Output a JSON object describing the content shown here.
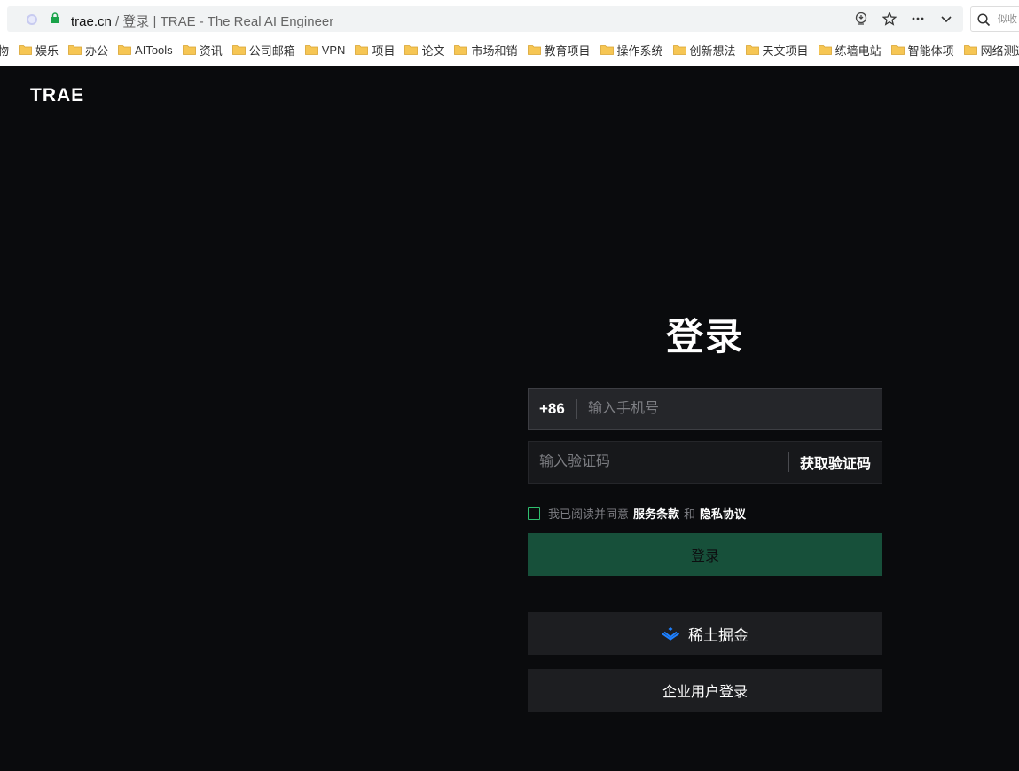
{
  "browser": {
    "url_host": "trae.cn",
    "url_rest": " / 登录 | TRAE - The Real AI Engineer",
    "search_text": "似收"
  },
  "bookmarks": [
    {
      "label": "物"
    },
    {
      "label": "娱乐"
    },
    {
      "label": "办公"
    },
    {
      "label": "AITools"
    },
    {
      "label": "资讯"
    },
    {
      "label": "公司邮箱"
    },
    {
      "label": "VPN"
    },
    {
      "label": "项目"
    },
    {
      "label": "论文"
    },
    {
      "label": "市场和销"
    },
    {
      "label": "教育项目"
    },
    {
      "label": "操作系统"
    },
    {
      "label": "创新想法"
    },
    {
      "label": "天文项目"
    },
    {
      "label": "练墙电站"
    },
    {
      "label": "智能体项"
    },
    {
      "label": "网络测速"
    }
  ],
  "page": {
    "logo_text": "TRAE",
    "title": "登录",
    "country_code": "+86",
    "phone_placeholder": "输入手机号",
    "code_placeholder": "输入验证码",
    "get_code_label": "获取验证码",
    "agree_prefix": "我已阅读并同意",
    "terms_label": "服务条款",
    "agree_and": "和",
    "privacy_label": "隐私协议",
    "login_label": "登录",
    "juejin_label": "稀土掘金",
    "enterprise_label": "企业用户登录"
  },
  "colors": {
    "background": "#0a0b0d",
    "accent_green": "#17503a",
    "checkbox_green": "#2fbf6f",
    "juejin_blue": "#1e80ff"
  }
}
